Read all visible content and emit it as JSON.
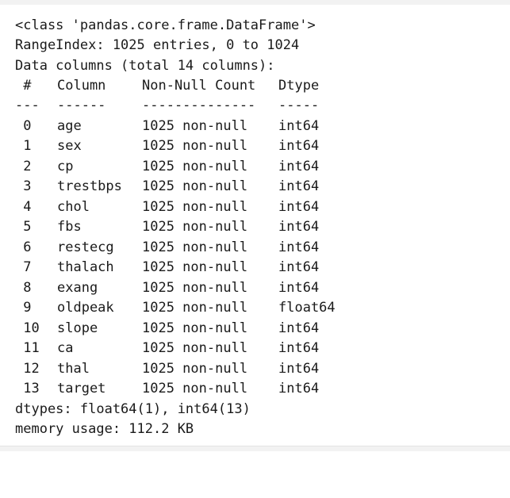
{
  "output": {
    "class_line": "<class 'pandas.core.frame.DataFrame'>",
    "range_index": "RangeIndex: 1025 entries, 0 to 1024",
    "data_columns": "Data columns (total 14 columns):",
    "headers": {
      "num": " #",
      "column": "Column",
      "count": "Non-Null Count",
      "dtype": "Dtype"
    },
    "separators": {
      "num": "---",
      "column": "------",
      "count": "--------------",
      "dtype": "-----"
    },
    "rows": [
      {
        "num": " 0",
        "name": "age",
        "count": "1025 non-null",
        "dtype": "int64"
      },
      {
        "num": " 1",
        "name": "sex",
        "count": "1025 non-null",
        "dtype": "int64"
      },
      {
        "num": " 2",
        "name": "cp",
        "count": "1025 non-null",
        "dtype": "int64"
      },
      {
        "num": " 3",
        "name": "trestbps",
        "count": "1025 non-null",
        "dtype": "int64"
      },
      {
        "num": " 4",
        "name": "chol",
        "count": "1025 non-null",
        "dtype": "int64"
      },
      {
        "num": " 5",
        "name": "fbs",
        "count": "1025 non-null",
        "dtype": "int64"
      },
      {
        "num": " 6",
        "name": "restecg",
        "count": "1025 non-null",
        "dtype": "int64"
      },
      {
        "num": " 7",
        "name": "thalach",
        "count": "1025 non-null",
        "dtype": "int64"
      },
      {
        "num": " 8",
        "name": "exang",
        "count": "1025 non-null",
        "dtype": "int64"
      },
      {
        "num": " 9",
        "name": "oldpeak",
        "count": "1025 non-null",
        "dtype": "float64"
      },
      {
        "num": " 10",
        "name": "slope",
        "count": "1025 non-null",
        "dtype": "int64"
      },
      {
        "num": " 11",
        "name": "ca",
        "count": "1025 non-null",
        "dtype": "int64"
      },
      {
        "num": " 12",
        "name": "thal",
        "count": "1025 non-null",
        "dtype": "int64"
      },
      {
        "num": " 13",
        "name": "target",
        "count": "1025 non-null",
        "dtype": "int64"
      }
    ],
    "dtypes_line": "dtypes: float64(1), int64(13)",
    "memory_line": "memory usage: 112.2 KB"
  }
}
